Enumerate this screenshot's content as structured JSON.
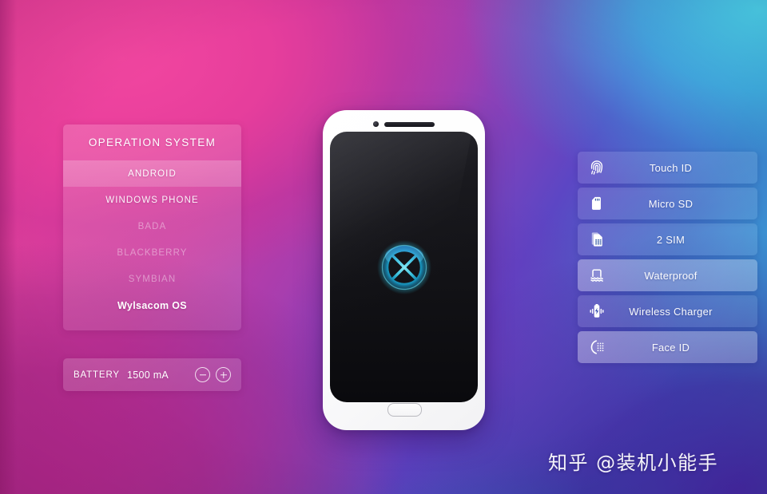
{
  "background": {
    "top_left_color": "#e8429a",
    "top_right_color": "#3fc8ea",
    "bottom_left_color": "#b2268c",
    "bottom_right_color": "#4624a5",
    "mid_violet_color": "#7634ba"
  },
  "os_panel": {
    "title": "OPERATION SYSTEM",
    "items": [
      {
        "label": "ANDROID",
        "state": "active",
        "selected": true
      },
      {
        "label": "WINDOWS PHONE",
        "state": "normal",
        "selected": false
      },
      {
        "label": "BADA",
        "state": "dim",
        "selected": false
      },
      {
        "label": "BLACKBERRY",
        "state": "dim",
        "selected": false
      },
      {
        "label": "SYMBIAN",
        "state": "dim",
        "selected": false
      },
      {
        "label": "Wylsacom OS",
        "state": "strong",
        "selected": false
      }
    ]
  },
  "battery_panel": {
    "label": "BATTERY",
    "value": "1500 mA",
    "decrease_icon": "minus-circle-icon",
    "increase_icon": "plus-circle-icon"
  },
  "phone": {
    "camera_icon": "front-camera-icon",
    "speaker_icon": "earpiece-speaker-icon",
    "logo_icon": "cyan-orb-logo-icon",
    "home_button_icon": "home-button-icon",
    "logo_color": "#3fd8f0",
    "screen_color": "#121216",
    "body_color": "#ffffff"
  },
  "features": [
    {
      "label": "Touch ID",
      "icon": "fingerprint-icon",
      "selected": false
    },
    {
      "label": "Micro SD",
      "icon": "sd-card-icon",
      "selected": false
    },
    {
      "label": "2 SIM",
      "icon": "sim-card-icon",
      "selected": false
    },
    {
      "label": "Waterproof",
      "icon": "waterproof-icon",
      "selected": true
    },
    {
      "label": "Wireless Charger",
      "icon": "wireless-charger-icon",
      "selected": false
    },
    {
      "label": "Face ID",
      "icon": "face-id-icon",
      "selected": true
    }
  ],
  "watermark": {
    "text": "知乎 @装机小能手"
  }
}
